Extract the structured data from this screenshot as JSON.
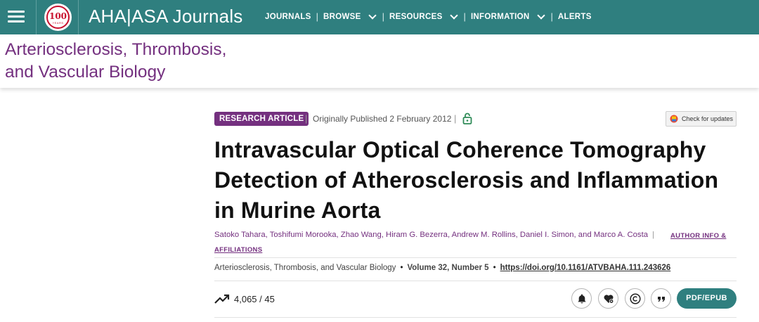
{
  "header": {
    "menu_icon": "hamburger-menu-icon",
    "logo": {
      "icon": "aha-100-years-logo",
      "text": "100",
      "subtext": "YEARS"
    },
    "brand": "AHA|ASA Journals",
    "nav": [
      {
        "label": "JOURNALS",
        "dropdown": false
      },
      {
        "label": "BROWSE",
        "dropdown": true
      },
      {
        "label": "RESOURCES",
        "dropdown": true
      },
      {
        "label": "INFORMATION",
        "dropdown": true
      },
      {
        "label": "ALERTS",
        "dropdown": false
      }
    ],
    "separator": "|"
  },
  "journal": {
    "title_line1": "Arteriosclerosis, Thrombosis,",
    "title_line2": "and Vascular Biology"
  },
  "article": {
    "type_badge": "RESEARCH ARTICLE",
    "published": "Originally Published 2 February 2012",
    "access_icon": "open-access-lock-icon",
    "check_updates": "Check for updates",
    "title": "Intravascular Optical Coherence Tomography Detection of Atherosclerosis and Inflammation in Murine Aorta",
    "authors": "Satoko Tahara, Toshifumi Morooka, Zhao Wang, Hiram G. Bezerra, Andrew M. Rollins, Daniel I. Simon, and Marco A. Costa",
    "author_info_label": "AUTHOR INFO &",
    "affiliations_label": "AFFILIATIONS",
    "citation": {
      "journal": "Arteriosclerosis, Thrombosis, and Vascular Biology",
      "volume": "Volume 32, Number 5",
      "doi": "https://doi.org/10.1161/ATVBAHA.111.243626"
    },
    "metrics": "4,065 / 45",
    "actions": {
      "icons": [
        "alert-bell-icon",
        "favorite-heart-icon",
        "permissions-copyright-icon",
        "cite-quote-icon"
      ],
      "pdf_label": "PDF/EPUB"
    }
  },
  "colors": {
    "nav_teal": "#2f7f7f",
    "journal_purple": "#74307f",
    "lock_green": "#2e8b57"
  }
}
